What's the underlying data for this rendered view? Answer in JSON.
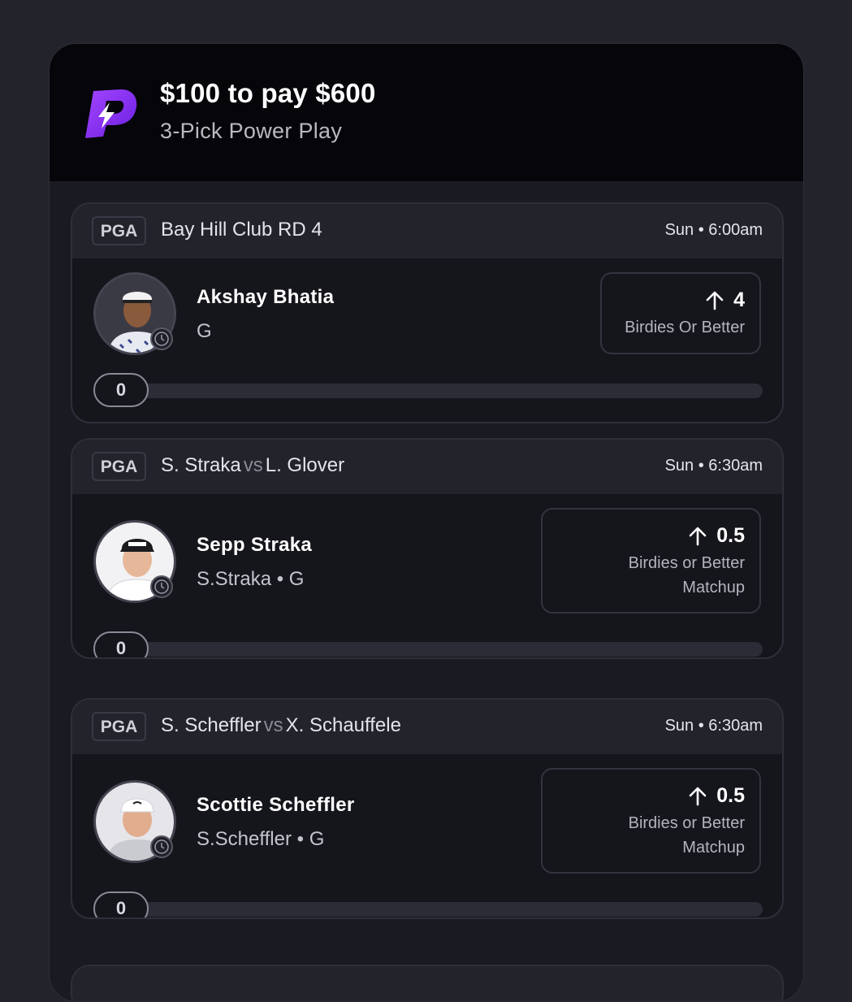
{
  "header": {
    "title": "$100 to pay $600",
    "subtitle": "3-Pick Power Play",
    "logo_color": "#7b2ff7"
  },
  "picks": [
    {
      "league": "PGA",
      "event": "Bay Hill Club RD 4",
      "event_a": "",
      "event_vs": "",
      "event_b": "",
      "time": "Sun • 6:00am",
      "player": "Akshay Bhatia",
      "player_sub": "G",
      "direction_icon": "arrow-up-icon",
      "line": "4",
      "stat": "Birdies Or Better",
      "stat2": "",
      "progress_value": "0",
      "progress_fraction": 0
    },
    {
      "league": "PGA",
      "event": "",
      "event_a": "S. Straka",
      "event_vs": "vs",
      "event_b": "L. Glover",
      "time": "Sun • 6:30am",
      "player": "Sepp Straka",
      "player_sub": "S.Straka • G",
      "direction_icon": "arrow-up-icon",
      "line": "0.5",
      "stat": "Birdies or Better",
      "stat2": "Matchup",
      "progress_value": "0",
      "progress_fraction": 0
    },
    {
      "league": "PGA",
      "event": "",
      "event_a": "S. Scheffler",
      "event_vs": "vs",
      "event_b": "X. Schauffele",
      "time": "Sun • 6:30am",
      "player": "Scottie Scheffler",
      "player_sub": "S.Scheffler • G",
      "direction_icon": "arrow-up-icon",
      "line": "0.5",
      "stat": "Birdies or Better",
      "stat2": "Matchup",
      "progress_value": "0",
      "progress_fraction": 0
    }
  ]
}
